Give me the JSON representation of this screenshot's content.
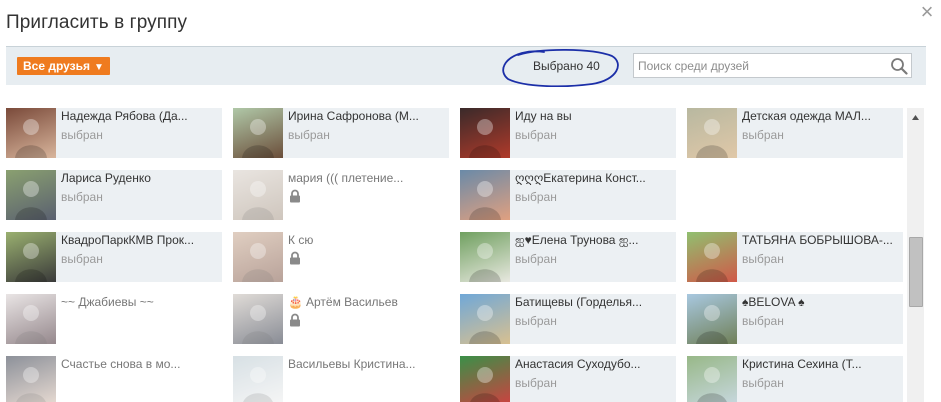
{
  "dialog": {
    "title": "Пригласить в группу",
    "close_glyph": "×"
  },
  "toolbar": {
    "filter_label": "Все друзья",
    "filter_arrow": "▼",
    "selected_label": "Выбрано 40",
    "search_placeholder": "Поиск среди друзей",
    "search_value": "",
    "annotation_color": "#1c2fa8"
  },
  "colors": {
    "accent": "#ef7b1f",
    "tile_selected_bg": "#ecf0f3"
  },
  "friends": [
    {
      "name": "Надежда Рябова (Да...",
      "status": "выбран",
      "selected": true,
      "photo": [
        "#7a4a3a",
        "#d8b59c"
      ]
    },
    {
      "name": "Ирина Сафронова (М...",
      "status": "выбран",
      "selected": true,
      "photo": [
        "#b0c8a8",
        "#6b4e3a"
      ]
    },
    {
      "name": "Иду на вы",
      "status": "выбран",
      "selected": true,
      "photo": [
        "#3a2a2a",
        "#b03a2a"
      ]
    },
    {
      "name": "Детская одежда МАЛ...",
      "status": "выбран",
      "selected": true,
      "photo": [
        "#b8b8a0",
        "#e0c8a8"
      ]
    },
    {
      "name": "Лариса Руденко",
      "status": "выбран",
      "selected": true,
      "photo": [
        "#8aa070",
        "#5a6070"
      ]
    },
    {
      "name": "мария ((( плетение...",
      "status": "",
      "locked": true,
      "selected": false,
      "photo": [
        "#d8d0c8",
        "#a89888"
      ]
    },
    {
      "name": "ღღღЕкатерина Конст...",
      "status": "выбран",
      "selected": true,
      "photo": [
        "#6a8aa8",
        "#e0a080"
      ]
    },
    {
      "empty": true
    },
    {
      "name": "КвадроПаркКМВ Прок...",
      "status": "выбран",
      "selected": true,
      "photo": [
        "#9ab070",
        "#3a3a3a"
      ]
    },
    {
      "name": "К сю",
      "status": "",
      "locked": true,
      "selected": false,
      "photo": [
        "#c8a890",
        "#805848"
      ]
    },
    {
      "name": "ஐ♥Елена Трунова ஐ...",
      "status": "выбран",
      "selected": true,
      "photo": [
        "#70a060",
        "#e8e8e0"
      ]
    },
    {
      "name": "ТАТЬЯНА БОБРЫШОВА-...",
      "status": "выбран",
      "selected": true,
      "photo": [
        "#90c070",
        "#d05848"
      ]
    },
    {
      "name": "~~ Джабиевы ~~",
      "status": "",
      "selected": false,
      "plain": true,
      "photo": [
        "#d8d0d0",
        "#402830"
      ]
    },
    {
      "name": "Артём Васильев",
      "status": "",
      "locked": true,
      "cake": "🎂",
      "selected": false,
      "photo": [
        "#c8c0b8",
        "#2a3040"
      ]
    },
    {
      "name": "Батищевы (Горделья...",
      "status": "выбран",
      "selected": true,
      "photo": [
        "#70a8d8",
        "#d8c090"
      ]
    },
    {
      "name": "♠BELOVA ♠",
      "status": "выбран",
      "selected": true,
      "photo": [
        "#a8c8e0",
        "#708058"
      ]
    },
    {
      "name": "Счастье снова в мо...",
      "status": "",
      "selected": false,
      "plain": true,
      "photo": [
        "#303848",
        "#d8c0b0"
      ]
    },
    {
      "name": "Васильевы Кристина...",
      "status": "",
      "selected": false,
      "plain": true,
      "photo": [
        "#b8c8d0",
        "#f0f0f0"
      ]
    },
    {
      "name": "Анастасия Суходубо...",
      "status": "выбран",
      "selected": true,
      "photo": [
        "#3a9048",
        "#d04040"
      ]
    },
    {
      "name": "Кристина Сехина (Т...",
      "status": "выбран",
      "selected": true,
      "photo": [
        "#98b888",
        "#c8d8e0"
      ]
    }
  ]
}
